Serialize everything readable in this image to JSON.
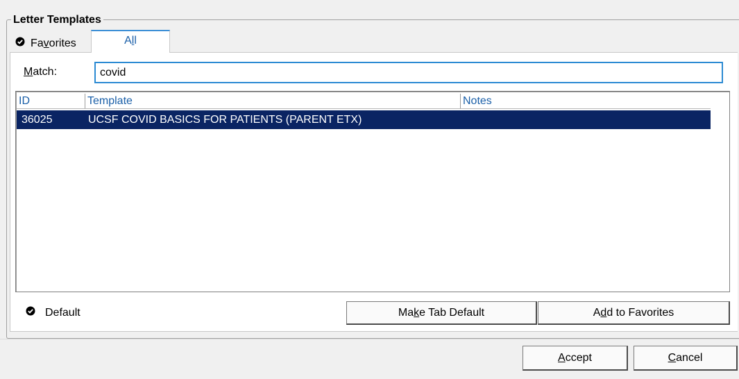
{
  "group": {
    "title": "Letter Templates"
  },
  "tabs": [
    {
      "pre": "Fa",
      "mnemonic": "v",
      "post": "orites",
      "selected": false,
      "icon": "check-circle-icon"
    },
    {
      "pre": "A",
      "mnemonic": "l",
      "post": "l",
      "selected": true
    }
  ],
  "match": {
    "pre": "",
    "mnemonic": "M",
    "post": "atch:",
    "value": "covid"
  },
  "list": {
    "columns": [
      "ID",
      "Template",
      "Notes"
    ],
    "rows": [
      {
        "id": "36025",
        "template": "UCSF COVID BASICS FOR PATIENTS (PARENT ETX)",
        "notes": "",
        "selected": true
      }
    ]
  },
  "default_label": "Default",
  "buttons": {
    "make_tab_default": {
      "pre": "Ma",
      "mnemonic": "k",
      "post": "e Tab Default"
    },
    "add_to_favorites": {
      "pre": "A",
      "mnemonic": "d",
      "post": "d to Favorites"
    },
    "accept": {
      "pre": "",
      "mnemonic": "A",
      "post": "ccept"
    },
    "cancel": {
      "pre": "",
      "mnemonic": "C",
      "post": "ancel"
    }
  },
  "colors": {
    "selection_bg": "#0a2463",
    "accent": "#2b8ad3",
    "header_text": "#1a5fa8"
  }
}
